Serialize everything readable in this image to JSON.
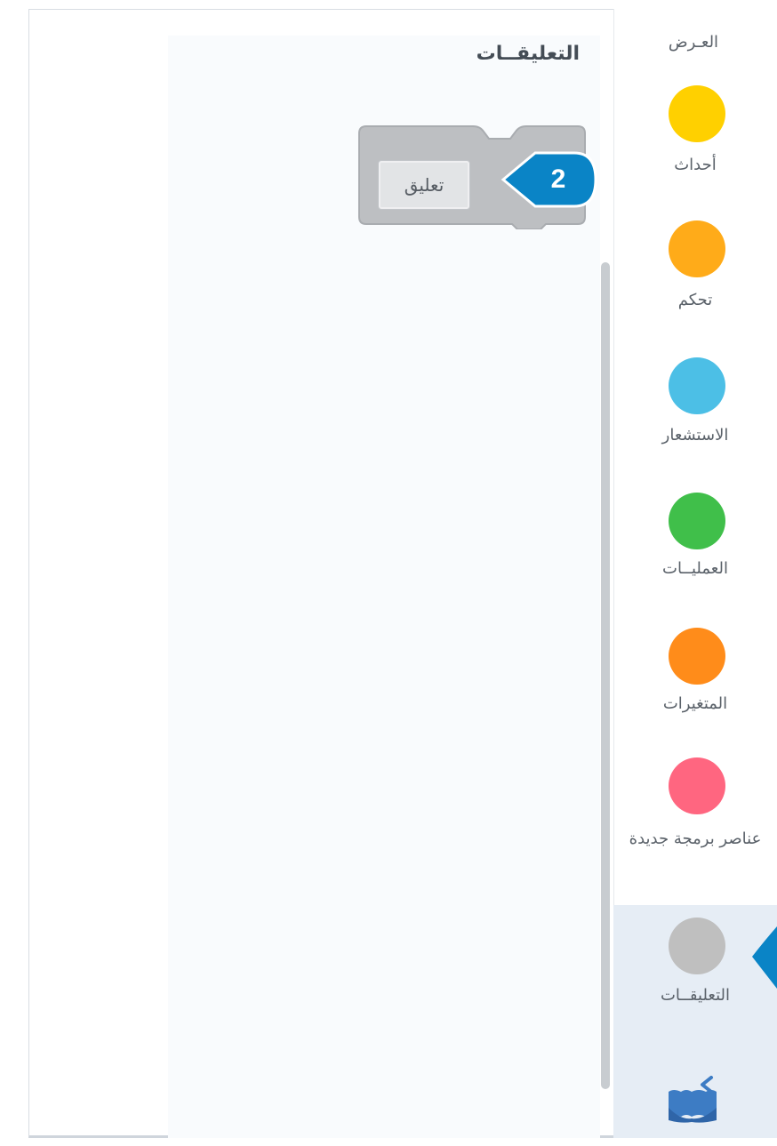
{
  "palette": {
    "title": "التعليقــات",
    "comment_block": {
      "input_text": "تعليق"
    },
    "callout_number": "2"
  },
  "categories": {
    "header": "العـرض",
    "items": [
      {
        "label": "أحداث",
        "color": "#ffd000"
      },
      {
        "label": "تحكم",
        "color": "#ffab19"
      },
      {
        "label": "الاستشعار",
        "color": "#4cbfe6"
      },
      {
        "label": "العمليــات",
        "color": "#40bf4a"
      },
      {
        "label": "المتغيرات",
        "color": "#ff8c1a"
      },
      {
        "label": "عناصر برمجة جديدة",
        "color": "#ff6680"
      },
      {
        "label": "التعليقــات",
        "color": "#bfbfbf"
      }
    ],
    "selected": "التعليقــات",
    "extension_icon": "add-extension-icon"
  },
  "colors": {
    "callout": "#0a84c6",
    "selected_bg": "#e6edf5",
    "block_gray": "#bdbfc2"
  }
}
